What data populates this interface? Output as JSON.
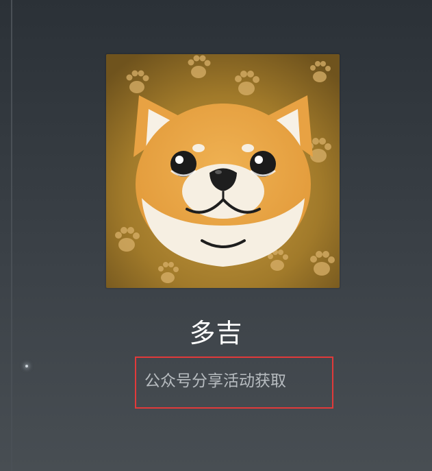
{
  "character": {
    "name": "多吉",
    "source": "公众号分享活动获取",
    "avatar_icon": "shiba-dog-avatar-icon",
    "highlight_color": "#e23a3a"
  }
}
